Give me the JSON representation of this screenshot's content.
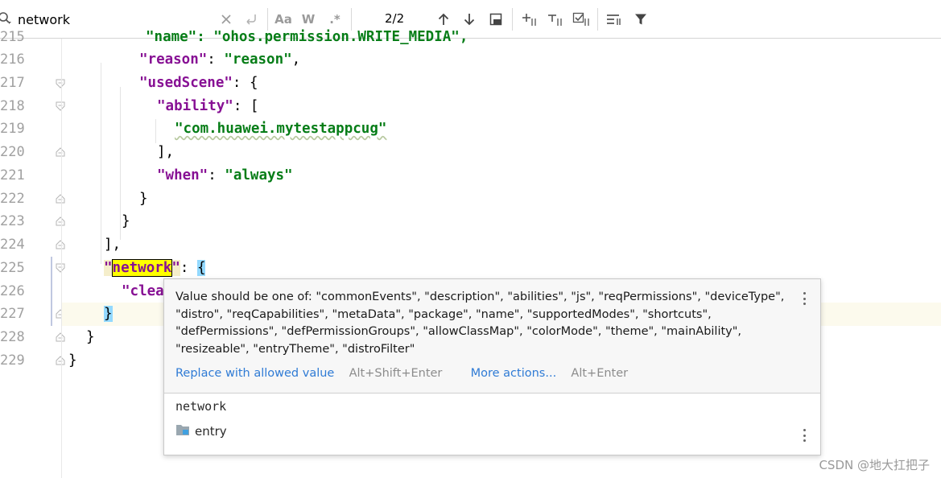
{
  "find_bar": {
    "query": "network",
    "match_case_label": "Aa",
    "words_label": "W",
    "regex_label": ".*",
    "match_count": "2/2",
    "icons": [
      "search-icon",
      "clear-icon",
      "replace-toggle-icon",
      "match-case-icon",
      "words-icon",
      "regex-icon",
      "prev-occurrence-icon",
      "next-occurrence-icon",
      "select-all-icon",
      "add-selection-icon",
      "exclude-selection-icon",
      "select-all-occurrences-icon",
      "multiline-icon",
      "filter-icon"
    ]
  },
  "line_numbers": [
    "215",
    "216",
    "217",
    "218",
    "219",
    "220",
    "221",
    "222",
    "223",
    "224",
    "225",
    "226",
    "227",
    "228",
    "229"
  ],
  "code": {
    "l215_partial": "\"name\": \"ohos.permission.WRITE_MEDIA\",",
    "l216_key": "\"reason\"",
    "l216_val": "\"reason\"",
    "l217_key": "\"usedScene\"",
    "l218_key": "\"ability\"",
    "l219_val": "\"com.huawei.mytestappcug\"",
    "l221_key": "\"when\"",
    "l221_val": "\"always\"",
    "l225_quote_open": "\"",
    "l225_match": "network",
    "l225_quote_close": "\"",
    "l226_partial": "\"clea",
    "l227_brace": "}"
  },
  "popup": {
    "message": "Value should be one of: \"commonEvents\", \"description\", \"abilities\", \"js\", \"reqPermissions\", \"deviceType\", \"distro\", \"reqCapabilities\", \"metaData\", \"package\", \"name\", \"supportedModes\", \"shortcuts\", \"defPermissions\", \"defPermissionGroups\", \"allowClassMap\", \"colorMode\", \"theme\", \"mainAbility\", \"resizeable\", \"entryTheme\", \"distroFilter\"",
    "action_primary": "Replace with allowed value",
    "action_primary_shortcut": "Alt+Shift+Enter",
    "action_more": "More actions...",
    "action_more_shortcut": "Alt+Enter",
    "element_name": "network",
    "module_name": "entry"
  },
  "watermark": "CSDN @地大扛把子",
  "colors": {
    "key": "#871094",
    "string": "#067d17",
    "find_highlight": "#ffff00",
    "brace_highlight": "#93d9ff",
    "link": "#2f7bd5"
  }
}
